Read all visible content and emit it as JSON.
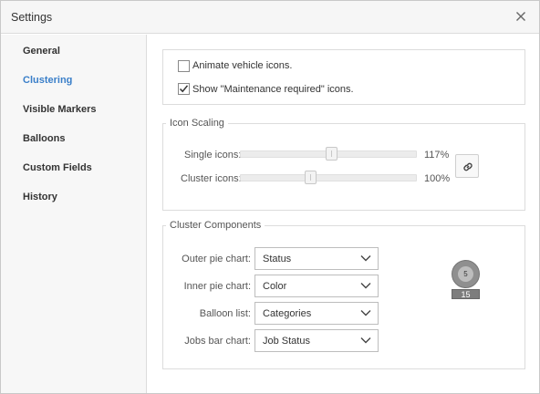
{
  "dialog": {
    "title": "Settings"
  },
  "sidebar": {
    "items": [
      {
        "label": "General",
        "active": false
      },
      {
        "label": "Clustering",
        "active": true
      },
      {
        "label": "Visible Markers",
        "active": false
      },
      {
        "label": "Balloons",
        "active": false
      },
      {
        "label": "Custom Fields",
        "active": false
      },
      {
        "label": "History",
        "active": false
      }
    ],
    "active_color": "#3a7fc9"
  },
  "options": {
    "animate_icons": {
      "label": "Animate vehicle icons.",
      "checked": false
    },
    "show_maintenance": {
      "label": "Show \"Maintenance required\" icons.",
      "checked": true
    }
  },
  "icon_scaling": {
    "legend": "Icon Scaling",
    "single": {
      "label": "Single icons:",
      "value": 117,
      "value_text": "117%"
    },
    "cluster": {
      "label": "Cluster icons:",
      "value": 100,
      "value_text": "100%"
    },
    "link_icon": "link-icon"
  },
  "cluster_components": {
    "legend": "Cluster Components",
    "outer_pie": {
      "label": "Outer pie chart:",
      "value": "Status"
    },
    "inner_pie": {
      "label": "Inner pie chart:",
      "value": "Color"
    },
    "balloon_list": {
      "label": "Balloon list:",
      "value": "Categories"
    },
    "jobs_bar": {
      "label": "Jobs bar chart:",
      "value": "Job Status"
    },
    "preview": {
      "inner_count": "5",
      "bar_count": "15"
    }
  }
}
